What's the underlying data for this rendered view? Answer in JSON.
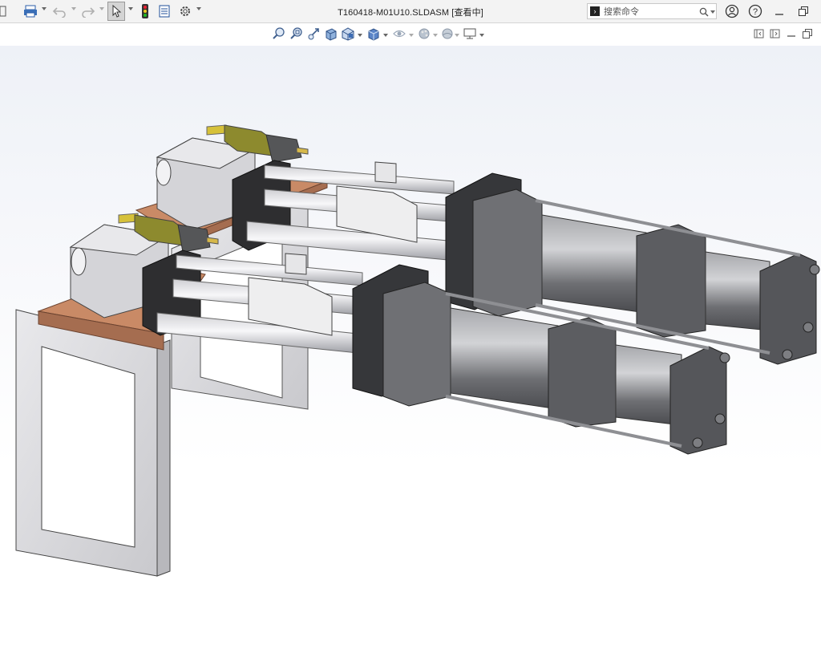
{
  "titlebar": {
    "document_title": "T160418-M01U10.SLDASM [查看中]",
    "search": {
      "placeholder": "搜索命令",
      "value": ""
    },
    "icons": [
      "menu-icon",
      "print-icon",
      "undo-icon",
      "redo-icon",
      "select-icon",
      "rebuild-traffic-light-icon",
      "file-properties-icon",
      "options-gear-icon",
      "search-icon",
      "user-account-icon",
      "help-icon",
      "minimize-icon",
      "restore-icon"
    ]
  },
  "view_toolbar": {
    "icons": [
      "zoom-to-fit-icon",
      "zoom-to-area-icon",
      "previous-view-icon",
      "section-view-icon",
      "view-orientation-icon",
      "display-style-icon",
      "hide-show-items-icon",
      "edit-appearance-icon",
      "apply-scene-icon",
      "view-settings-icon",
      "collapse-left-icon",
      "expand-right-icon",
      "panel-minimize-icon",
      "panel-restore-icon"
    ]
  },
  "viewport": {
    "content": "3D assembly model of two pneumatic cylinder slide units mounted on plates",
    "colors": {
      "plate": "#d9d9d9",
      "copper_plate": "#c98a66",
      "cylinder": "#6e6f73",
      "rod": "#e6e6e9",
      "sensor": "#8d8a2e",
      "bracket": "#2e2e30"
    }
  }
}
